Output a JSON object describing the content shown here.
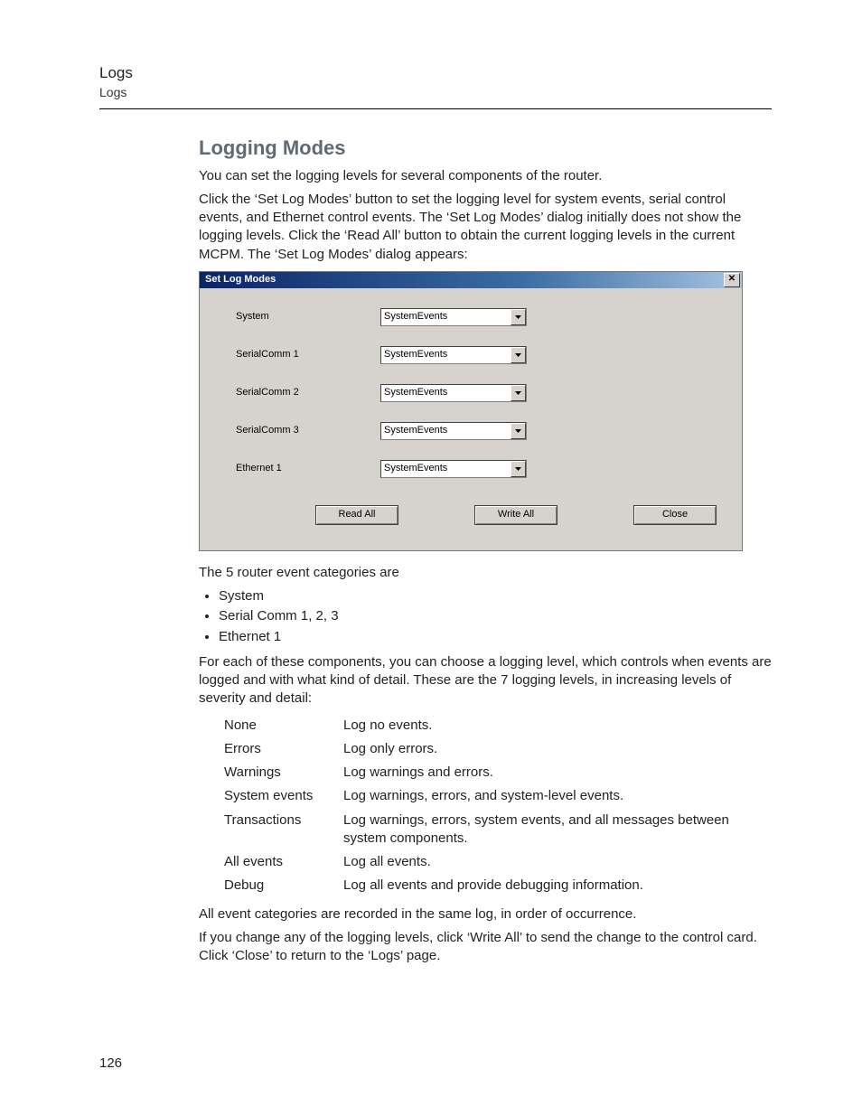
{
  "header": {
    "title": "Logs",
    "subtitle": "Logs"
  },
  "section_title": "Logging Modes",
  "intro": "You can set the logging levels for several components of the router.",
  "para2": "Click the ‘Set Log Modes’ button to set the logging level for system events, serial control events, and Ethernet control events. The ‘Set Log Modes’ dialog initially does not show the logging levels. Click the ‘Read All’ button to obtain the current logging levels in the current MCPM. The ‘Set Log Modes’ dialog appears:",
  "dialog": {
    "title": "Set Log Modes",
    "close_glyph": "✕",
    "rows": [
      {
        "label": "System",
        "value": "SystemEvents"
      },
      {
        "label": "SerialComm 1",
        "value": "SystemEvents"
      },
      {
        "label": "SerialComm 2",
        "value": "SystemEvents"
      },
      {
        "label": "SerialComm 3",
        "value": "SystemEvents"
      },
      {
        "label": "Ethernet 1",
        "value": "SystemEvents"
      }
    ],
    "buttons": {
      "read": "Read All",
      "write": "Write All",
      "close": "Close"
    }
  },
  "after_dialog": "The 5 router event categories are",
  "categories": [
    "System",
    "Serial Comm 1, 2, 3",
    "Ethernet 1"
  ],
  "para3": "For each of these components, you can choose a logging level, which controls when events are logged and with what kind of detail. These are the 7 logging levels, in increasing levels of severity and detail:",
  "levels": [
    {
      "name": "None",
      "desc": "Log no events."
    },
    {
      "name": "Errors",
      "desc": "Log only errors."
    },
    {
      "name": "Warnings",
      "desc": "Log warnings and errors."
    },
    {
      "name": "System events",
      "desc": "Log warnings, errors, and system-level events."
    },
    {
      "name": "Transactions",
      "desc": "Log warnings, errors, system events, and all messages between system components."
    },
    {
      "name": "All events",
      "desc": "Log all events."
    },
    {
      "name": "Debug",
      "desc": "Log all events and provide debugging information."
    }
  ],
  "para4": "All event categories are recorded in the same log, in order of occurrence.",
  "para5": "If you change any of the logging levels, click ‘Write All’ to send the change to the control card. Click ‘Close’ to return to the ‘Logs’ page.",
  "page_number": "126"
}
